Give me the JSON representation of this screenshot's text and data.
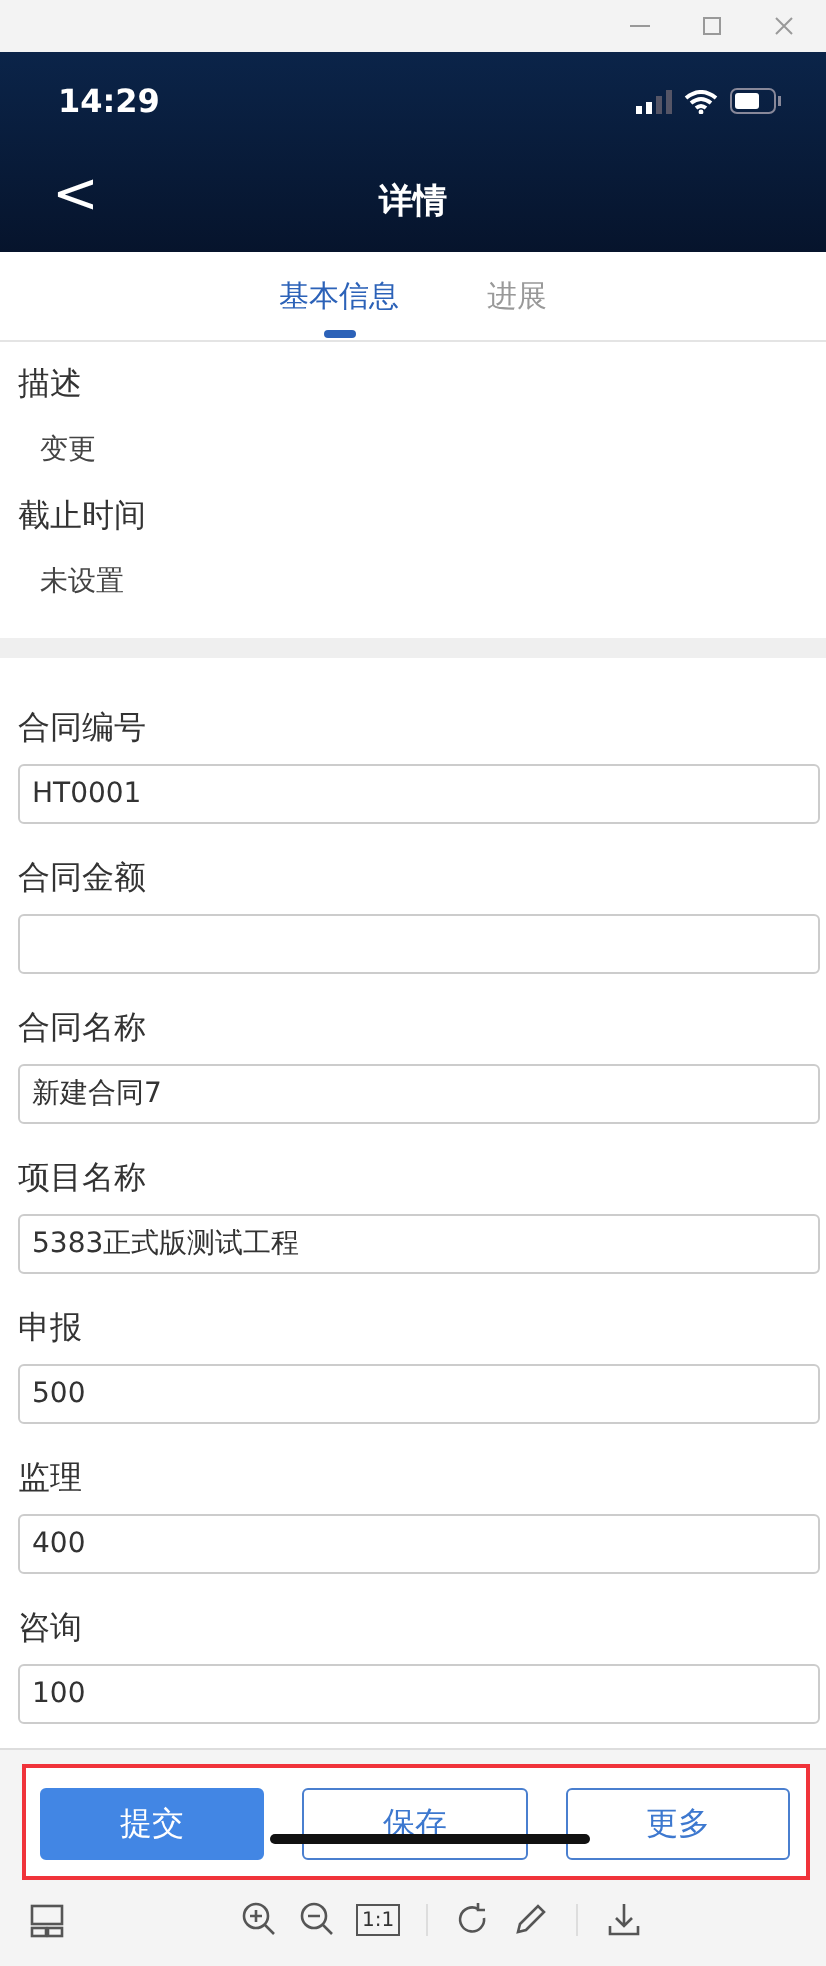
{
  "status_bar": {
    "time": "14:29"
  },
  "nav": {
    "back": "<",
    "title": "详情"
  },
  "tabs": [
    {
      "label": "基本信息",
      "selected": true
    },
    {
      "label": "进展",
      "selected": false
    }
  ],
  "info": [
    {
      "label": "描述",
      "value": "变更"
    },
    {
      "label": "截止时间",
      "value": "未设置"
    }
  ],
  "fields": [
    {
      "label": "合同编号",
      "value": "HT0001"
    },
    {
      "label": "合同金额"
    },
    {
      "label": "合同名称",
      "value": "新建合同7"
    },
    {
      "label": "项目名称",
      "value": "5383正式版测试工程"
    },
    {
      "label": "申报",
      "value": "500"
    },
    {
      "label": "监理",
      "value": "400"
    },
    {
      "label": "咨询",
      "value": "100"
    }
  ],
  "actions": [
    {
      "label": "提交",
      "kind": "primary"
    },
    {
      "label": "保存",
      "kind": "outline"
    },
    {
      "label": "更多",
      "kind": "outline"
    }
  ],
  "viewer_toolbar": {
    "zoom_reset": "1:1"
  }
}
